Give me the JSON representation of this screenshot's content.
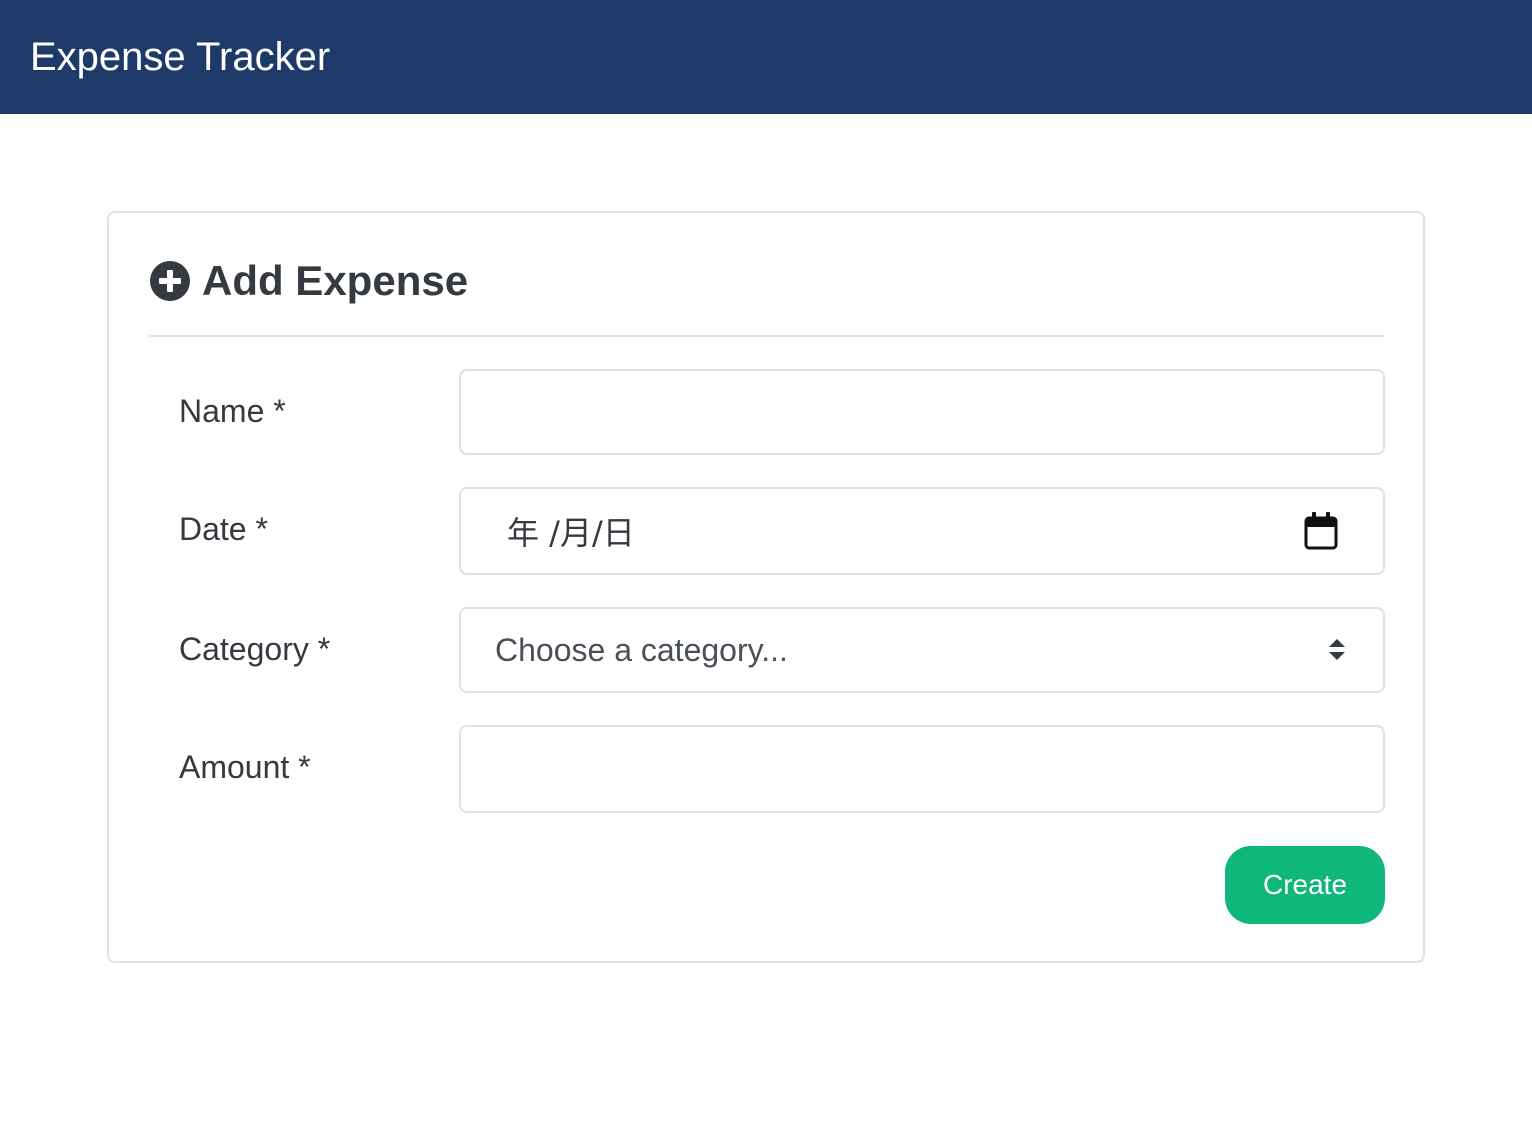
{
  "app": {
    "title": "Expense Tracker"
  },
  "form": {
    "title": "Add Expense",
    "header_icon": "plus-circle-icon",
    "fields": {
      "name": {
        "label": "Name *",
        "value": "",
        "placeholder": ""
      },
      "date": {
        "label": "Date *",
        "display": "年 /月/日",
        "icon": "calendar-icon"
      },
      "category": {
        "label": "Category *",
        "selected": "Choose a category...",
        "icon": "up-down-arrows-icon"
      },
      "amount": {
        "label": "Amount *",
        "value": "",
        "placeholder": ""
      }
    },
    "submit_label": "Create"
  },
  "colors": {
    "navbar": "#1e3a68",
    "submit_button": "#10b77a",
    "text": "#343a40",
    "border": "#dee2e6"
  }
}
